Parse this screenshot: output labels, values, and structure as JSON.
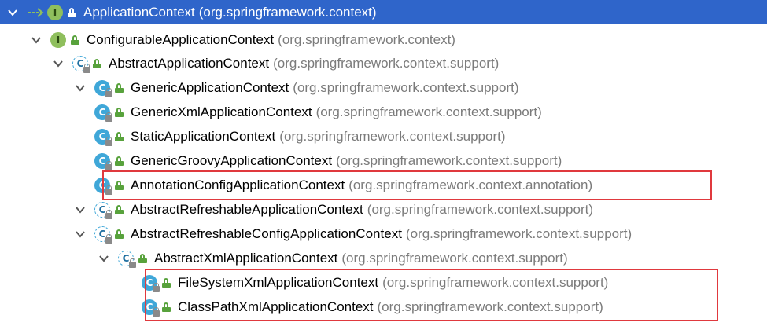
{
  "tree": {
    "nodes": [
      {
        "name": "ApplicationContext",
        "pkg": "(org.springframework.context)",
        "kind": "interface",
        "depth": 0,
        "expanded": true,
        "selected": true
      },
      {
        "name": "ConfigurableApplicationContext",
        "pkg": "(org.springframework.context)",
        "kind": "interface",
        "depth": 1,
        "expanded": true
      },
      {
        "name": "AbstractApplicationContext",
        "pkg": "(org.springframework.context.support)",
        "kind": "abstract",
        "depth": 2,
        "expanded": true
      },
      {
        "name": "GenericApplicationContext",
        "pkg": "(org.springframework.context.support)",
        "kind": "class",
        "depth": 3,
        "expanded": true
      },
      {
        "name": "GenericXmlApplicationContext",
        "pkg": "(org.springframework.context.support)",
        "kind": "class",
        "depth": 4,
        "leaf": true
      },
      {
        "name": "StaticApplicationContext",
        "pkg": "(org.springframework.context.support)",
        "kind": "class",
        "depth": 4,
        "leaf": true
      },
      {
        "name": "GenericGroovyApplicationContext",
        "pkg": "(org.springframework.context.support)",
        "kind": "class",
        "depth": 4,
        "leaf": true
      },
      {
        "name": "AnnotationConfigApplicationContext",
        "pkg": "(org.springframework.context.annotation)",
        "kind": "class",
        "depth": 4,
        "leaf": true
      },
      {
        "name": "AbstractRefreshableApplicationContext",
        "pkg": "(org.springframework.context.support)",
        "kind": "abstract",
        "depth": 3,
        "expanded": true
      },
      {
        "name": "AbstractRefreshableConfigApplicationContext",
        "pkg": "(org.springframework.context.support)",
        "kind": "abstract",
        "depth": 4,
        "expanded": true
      },
      {
        "name": "AbstractXmlApplicationContext",
        "pkg": "(org.springframework.context.support)",
        "kind": "abstract",
        "depth": 5,
        "expanded": true
      },
      {
        "name": "FileSystemXmlApplicationContext",
        "pkg": "(org.springframework.context.support)",
        "kind": "class",
        "depth": 6,
        "leaf": true
      },
      {
        "name": "ClassPathXmlApplicationContext",
        "pkg": "(org.springframework.context.support)",
        "kind": "class",
        "depth": 6,
        "leaf": true
      }
    ],
    "icon_letters": {
      "interface": "I",
      "class": "C",
      "abstract": "C"
    },
    "colors": {
      "selection": "#2f65ca",
      "highlight_border": "#e0393e",
      "package_text": "#7b7b7b"
    }
  }
}
